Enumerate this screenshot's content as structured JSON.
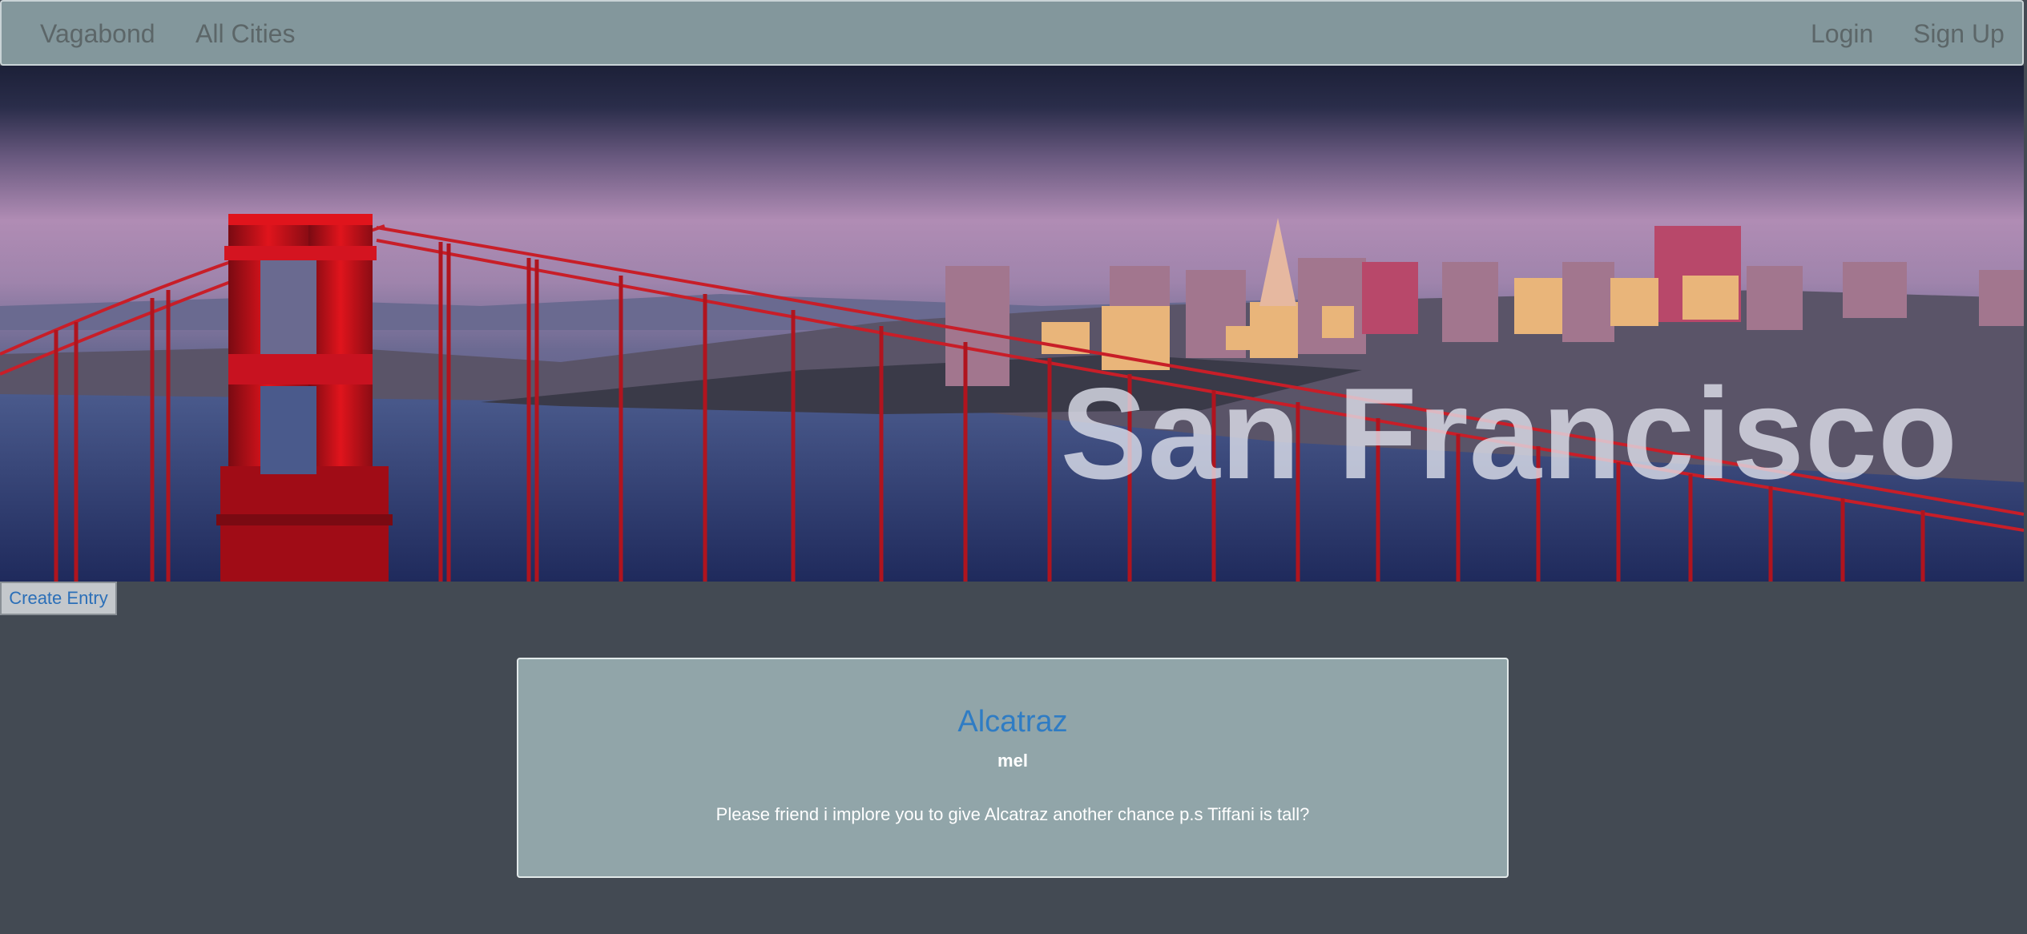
{
  "navbar": {
    "brand": "Vagabond",
    "links_left": [
      "All Cities"
    ],
    "links_right": [
      "Login",
      "Sign Up"
    ]
  },
  "hero": {
    "city_name": "San Francisco",
    "image_icon": "san-francisco-golden-gate-bridge-photo"
  },
  "actions": {
    "create_entry_label": "Create Entry"
  },
  "entries": [
    {
      "title": "Alcatraz",
      "author": "mel",
      "body": "Please friend i implore you to give Alcatraz another chance p.s Tiffani is tall?"
    }
  ],
  "colors": {
    "navbar_bg": "#83979c",
    "page_bg": "#434a53",
    "card_bg": "#91a5a9",
    "link": "#2f7cc4"
  }
}
